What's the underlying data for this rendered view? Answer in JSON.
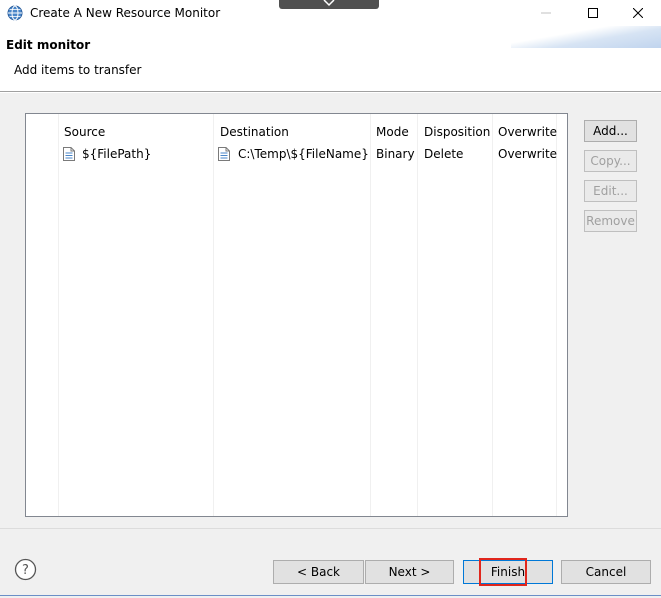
{
  "window": {
    "title": "Create A New Resource Monitor",
    "minimize_glyph": "—",
    "maximize_glyph": "☐",
    "close_glyph": "✕"
  },
  "header": {
    "title": "Edit monitor",
    "subtitle": "Add items to transfer"
  },
  "table": {
    "columns": [
      "Source",
      "Destination",
      "Mode",
      "Disposition",
      "Overwrite"
    ],
    "rows": [
      {
        "source": "${FilePath}",
        "destination": "C:\\Temp\\${FileName}",
        "mode": "Binary",
        "disposition": "Delete",
        "overwrite": "Overwrite"
      }
    ]
  },
  "side_buttons": {
    "add": "Add...",
    "copy": "Copy...",
    "edit": "Edit...",
    "remove": "Remove"
  },
  "footer": {
    "back": "< Back",
    "next": "Next >",
    "finish": "Finish",
    "cancel": "Cancel"
  },
  "colors": {
    "accent": "#0078d7",
    "highlight": "#e0261c"
  },
  "icons": {
    "app": "globe-icon",
    "file": "file-icon",
    "help": "help-icon"
  }
}
